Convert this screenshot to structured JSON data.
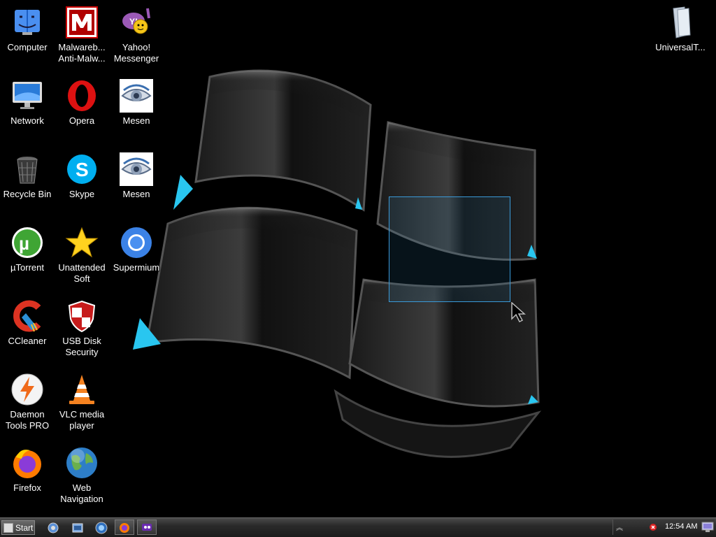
{
  "desktop": {
    "icons": [
      {
        "name": "computer",
        "label": "Computer"
      },
      {
        "name": "malwarebytes",
        "label": "Malwareb...\nAnti-Malw..."
      },
      {
        "name": "yahoo-messenger",
        "label": "Yahoo!\nMessenger"
      },
      {
        "name": "network",
        "label": "Network"
      },
      {
        "name": "opera",
        "label": "Opera"
      },
      {
        "name": "mesen-1",
        "label": "Mesen"
      },
      {
        "name": "recycle-bin",
        "label": "Recycle Bin"
      },
      {
        "name": "skype",
        "label": "Skype"
      },
      {
        "name": "mesen-2",
        "label": "Mesen"
      },
      {
        "name": "utorrent",
        "label": "µTorrent"
      },
      {
        "name": "unattended-soft",
        "label": "Unattended\nSoft"
      },
      {
        "name": "supermium",
        "label": "Supermium"
      },
      {
        "name": "ccleaner",
        "label": "CCleaner"
      },
      {
        "name": "usb-disk-security",
        "label": "USB Disk\nSecurity"
      },
      {
        "name": "daemon-tools",
        "label": "Daemon\nTools PRO"
      },
      {
        "name": "vlc",
        "label": "VLC media\nplayer"
      },
      {
        "name": "firefox",
        "label": "Firefox"
      },
      {
        "name": "web-navigation",
        "label": "Web\nNavigation"
      },
      {
        "name": "universal-theme",
        "label": "UniversalT..."
      }
    ]
  },
  "taskbar": {
    "start_label": "Start",
    "clock": "12:54 AM"
  }
}
